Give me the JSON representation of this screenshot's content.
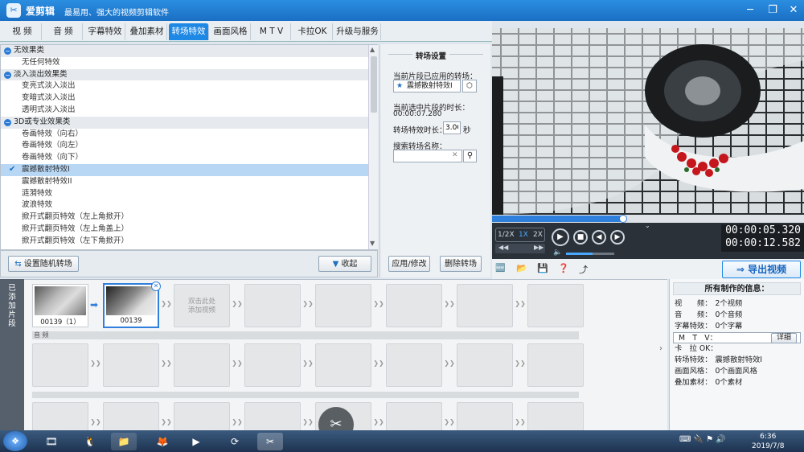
{
  "app": {
    "logo": "✂",
    "name": "爱剪辑",
    "slogan": "最易用、强大的视频剪辑软件"
  },
  "window_buttons": {
    "minimize": "─",
    "restore": "❐",
    "close": "✕"
  },
  "tabs": [
    {
      "label": "视 频"
    },
    {
      "label": "音 频"
    },
    {
      "label": "字幕特效"
    },
    {
      "label": "叠加素材"
    },
    {
      "label": "转场特效"
    },
    {
      "label": "画面风格"
    },
    {
      "label": "M T V"
    },
    {
      "label": "卡拉OK"
    },
    {
      "label": "升级与服务"
    }
  ],
  "effects": {
    "rows": [
      {
        "type": "cat",
        "label": "无效果类",
        "icon": "−"
      },
      {
        "type": "item",
        "label": "无任何特效"
      },
      {
        "type": "cat",
        "label": "淡入淡出效果类",
        "icon": "−"
      },
      {
        "type": "item",
        "label": "变亮式淡入淡出"
      },
      {
        "type": "item",
        "label": "变暗式淡入淡出"
      },
      {
        "type": "item",
        "label": "透明式淡入淡出"
      },
      {
        "type": "cat",
        "label": "3D或专业效果类",
        "icon": "−"
      },
      {
        "type": "item",
        "label": "卷画特效（向右）"
      },
      {
        "type": "item",
        "label": "卷画特效（向左）"
      },
      {
        "type": "item",
        "label": "卷画特效（向下）"
      },
      {
        "type": "item",
        "label": "震撼散射特效I",
        "selected": true,
        "check": "✔"
      },
      {
        "type": "item",
        "label": "震撼散射特效II"
      },
      {
        "type": "item",
        "label": "涟漪特效"
      },
      {
        "type": "item",
        "label": "波浪特效"
      },
      {
        "type": "item",
        "label": "掀开式翻页特效（左上角掀开）"
      },
      {
        "type": "item",
        "label": "掀开式翻页特效（左上角盖上）"
      },
      {
        "type": "item",
        "label": "掀开式翻页特效（左下角掀开）"
      }
    ],
    "random_button": "设置随机转场",
    "collapse_button": "收起"
  },
  "settings": {
    "title": "转场设置",
    "applied_label": "当前片段已应用的转场：",
    "applied_value": "震撼散射特效I",
    "clip_duration_label": "当前选中片段的时长：",
    "clip_duration_value": "00:00:07.280",
    "effect_duration_label": "转场特效时长：",
    "effect_duration_value": "3.00",
    "effect_duration_unit": "秒",
    "search_label": "搜索转场名称：",
    "search_placeholder": "",
    "apply_button": "应用/修改",
    "delete_button": "删除转场"
  },
  "player": {
    "speed_options": [
      "1/2X",
      "1X",
      "2X"
    ],
    "current_time": "00:00:05.320",
    "total_time": "00:00:12.582",
    "progress": 0.42,
    "volume": 0.55,
    "export_button": "导出视频"
  },
  "timeline": {
    "side_label": "已添加片段",
    "clips": [
      {
        "label": "00139（1）"
      },
      {
        "label": "00139",
        "selected": true
      }
    ],
    "add_hint": "双击此处\n添加视频",
    "audio_label": "音 频"
  },
  "info": {
    "title": "所有制作的信息：",
    "rows": [
      {
        "label": "视　　频：",
        "value": "2个视频"
      },
      {
        "label": "音　　频：",
        "value": "0个音频"
      },
      {
        "label": "字幕特效：",
        "value": "0个字幕"
      },
      {
        "label": "M　T　V：",
        "value": ""
      },
      {
        "label": "卡　拉 OK：",
        "value": ""
      },
      {
        "label": "转场特效：",
        "value": "震撼散射特效I"
      },
      {
        "label": "画面风格：",
        "value": "0个画面风格"
      },
      {
        "label": "叠加素材：",
        "value": "0个素材"
      }
    ],
    "detail_button": "详细"
  },
  "taskbar": {
    "clock_time": "6:36",
    "clock_date": "2019/7/8"
  },
  "colors": {
    "accent": "#1e88e5",
    "titlebar": "#1a6fc4"
  }
}
